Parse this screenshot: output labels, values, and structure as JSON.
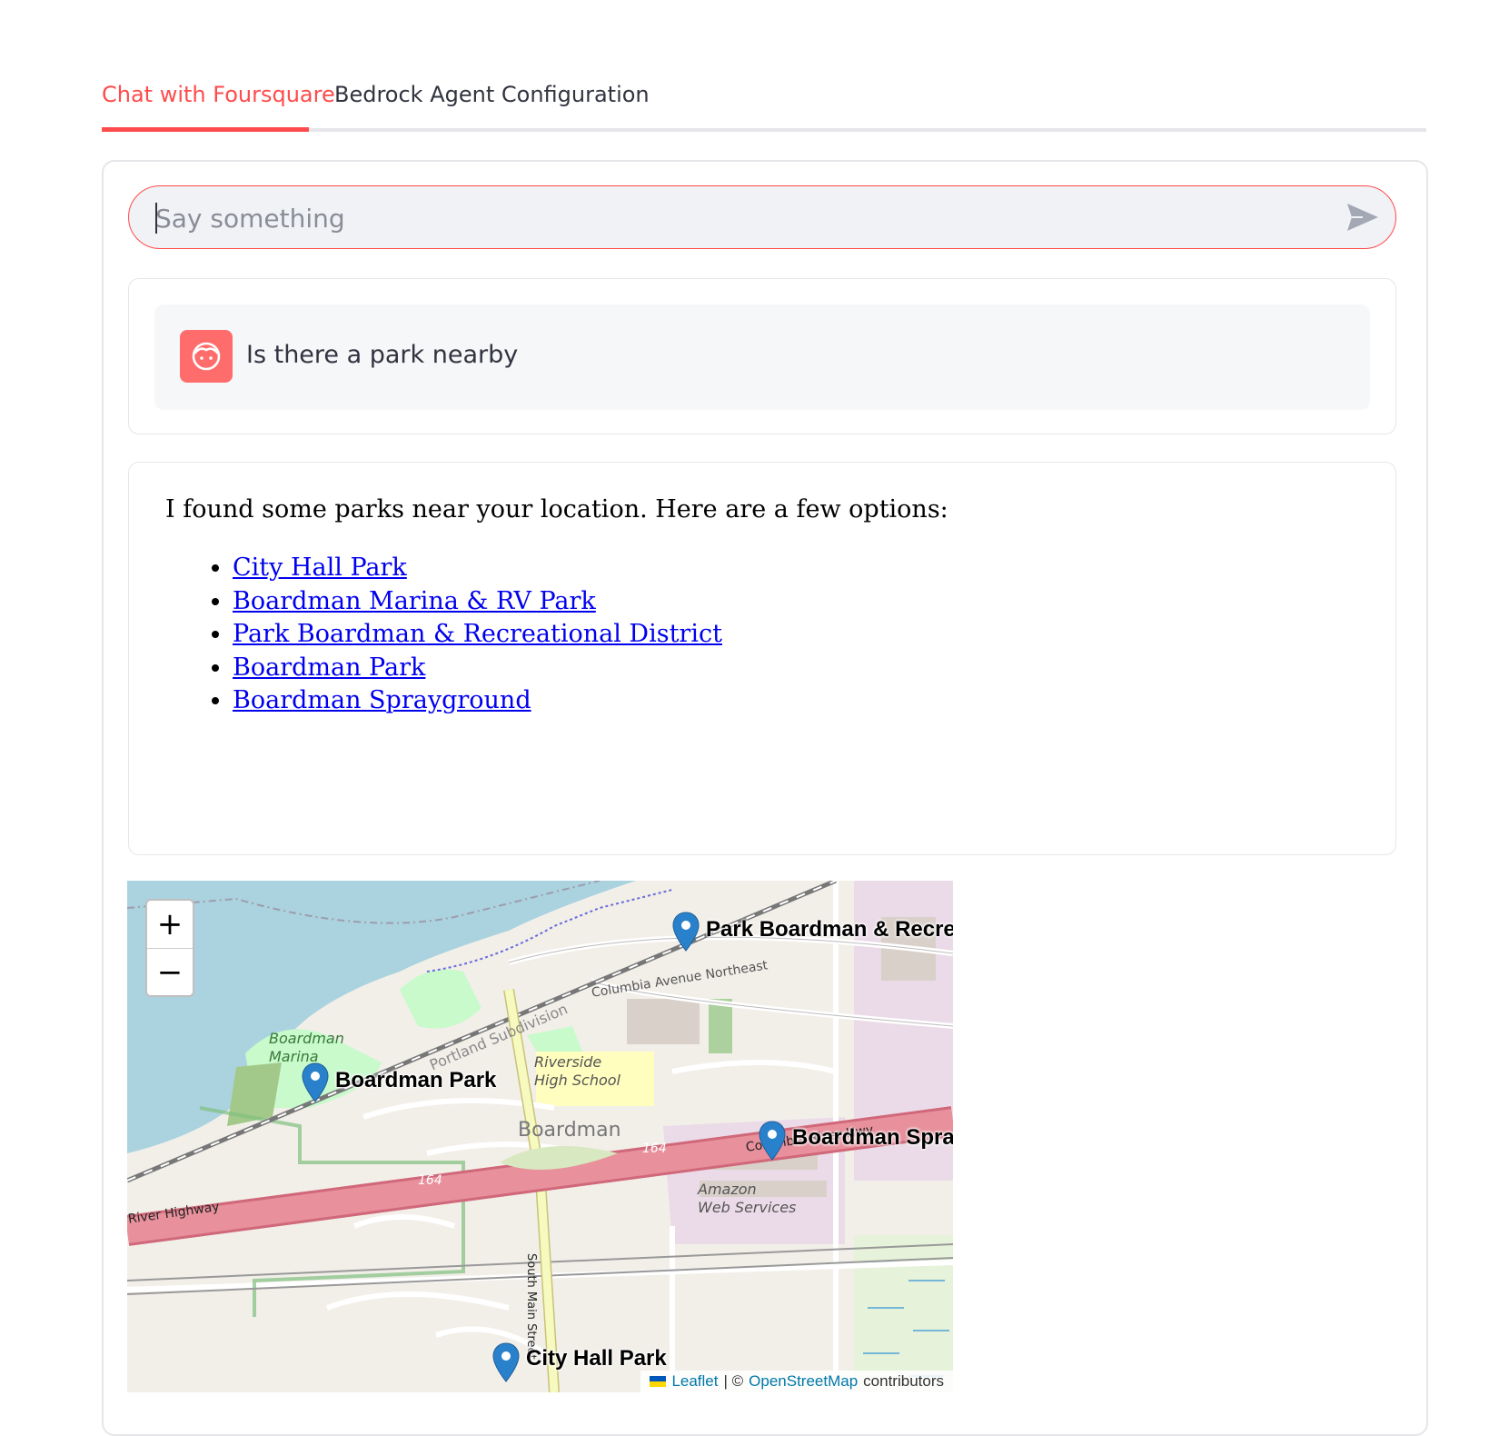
{
  "tabs": [
    {
      "label": "Chat with Foursquare",
      "active": true
    },
    {
      "label": "Bedrock Agent Configuration",
      "active": false
    }
  ],
  "chat_input": {
    "placeholder": "Say something",
    "value": ""
  },
  "user_message": {
    "text": "Is there a park nearby",
    "avatar": "user-face-icon"
  },
  "assistant_message": {
    "intro": "I found some parks near your location. Here are a few options:",
    "links": [
      "City Hall Park",
      "Boardman Marina & RV Park",
      "Park Boardman & Recreational District",
      "Boardman Park",
      "Boardman Sprayground"
    ]
  },
  "map": {
    "zoom_in": "+",
    "zoom_out": "−",
    "markers": [
      {
        "label": "Park Boardman & Recreational District"
      },
      {
        "label": "Boardman Park"
      },
      {
        "label": "Boardman Sprayground"
      },
      {
        "label": "City Hall Park"
      }
    ],
    "place_labels": {
      "town": "Boardman",
      "school": "Riverside\nHigh School",
      "marina": "Boardman\nMarina",
      "amazon": "Amazon\nWeb Services",
      "columbia_ave": "Columbia Avenue Northeast",
      "rail": "Portland Subdivision",
      "river_highway": "River Highway",
      "columbia_river_hwy": "Columbia River Hwy",
      "south_main": "South Main Street",
      "hwy_164": "164"
    },
    "attribution": {
      "leaflet": "Leaflet",
      "separator": " | © ",
      "osm": "OpenStreetMap",
      "suffix": "contributors"
    }
  },
  "colors": {
    "accent": "#ff4b4b",
    "link": "#0000ee",
    "marker": "#2a81cb",
    "highway": "#e8909c"
  }
}
